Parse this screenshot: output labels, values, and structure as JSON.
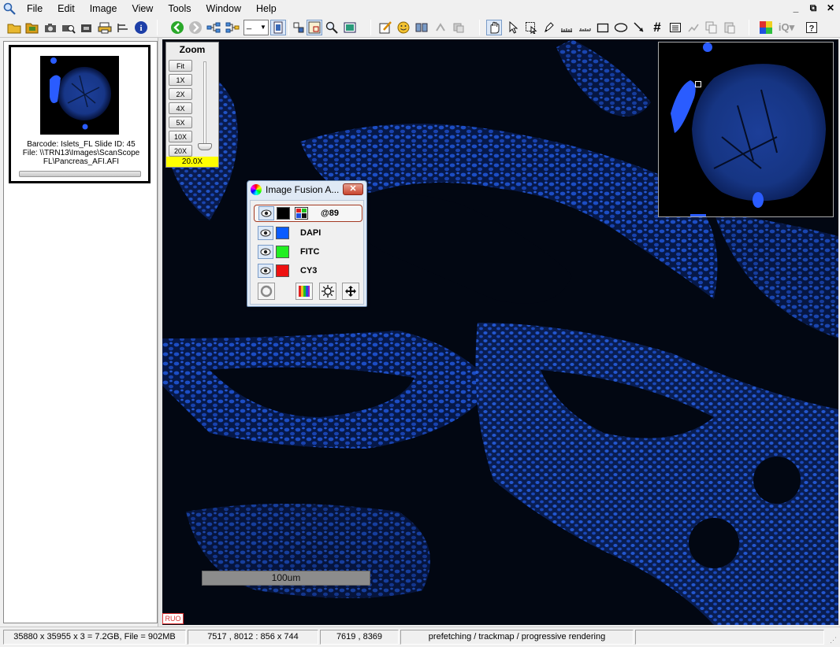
{
  "menu": [
    "File",
    "Edit",
    "Image",
    "View",
    "Tools",
    "Window",
    "Help"
  ],
  "window_buttons": [
    "_",
    "⧉",
    "✕"
  ],
  "toolbar": {
    "zoom_value": "_",
    "tools": [
      "open-icon",
      "open-folder-icon",
      "camera-icon",
      "search-camera-icon",
      "snapshot-icon",
      "print-icon",
      "arrange-icon",
      "info-icon",
      "back-icon",
      "forward-icon",
      "tree-icon",
      "tree-alt-icon",
      "zoom-combo",
      "fit-icon",
      "grid-view-icon",
      "overview-icon",
      "magnify-icon",
      "presentation-icon",
      "annotate-icon",
      "smile-icon",
      "compare-icon",
      "sync-icon",
      "sync-alt-icon",
      "hand-icon",
      "select-icon",
      "region-icon",
      "pen-icon",
      "ruler-icon",
      "rectangle-icon",
      "ellipse-icon",
      "arrow-icon",
      "grid-icon",
      "notes-icon",
      "chart-icon",
      "copy-icon",
      "paste-icon",
      "color-icon",
      "iq-icon",
      "help-icon"
    ]
  },
  "thumbnail": {
    "barcode_line": "Barcode: Islets_FL   Slide ID: 45",
    "file_line1": "File: \\\\TRN13\\Images\\ScanScope",
    "file_line2": "FL\\Pancreas_AFI.AFI"
  },
  "zoom": {
    "title": "Zoom",
    "buttons": [
      "Fit",
      "1X",
      "2X",
      "4X",
      "5X",
      "10X",
      "20X"
    ],
    "level": "20.0X"
  },
  "fusion": {
    "title": "Image Fusion A...",
    "close": "✕",
    "channels": [
      {
        "label": "@89",
        "color": "#000000",
        "selected": true
      },
      {
        "label": "DAPI",
        "color": "#0a5cff",
        "selected": false
      },
      {
        "label": "FITC",
        "color": "#22ee22",
        "selected": false
      },
      {
        "label": "CY3",
        "color": "#ee1111",
        "selected": false
      }
    ]
  },
  "scale_bar": "100um",
  "ruo": "RUO",
  "status": {
    "dims": "35880 x 35955 x 3 = 7.2GB, File = 902MB",
    "view": "7517 , 8012 : 856 x 744",
    "cursor": "7619 , 8369",
    "message": "prefetching / trackmap / progressive rendering",
    "extra": ""
  }
}
